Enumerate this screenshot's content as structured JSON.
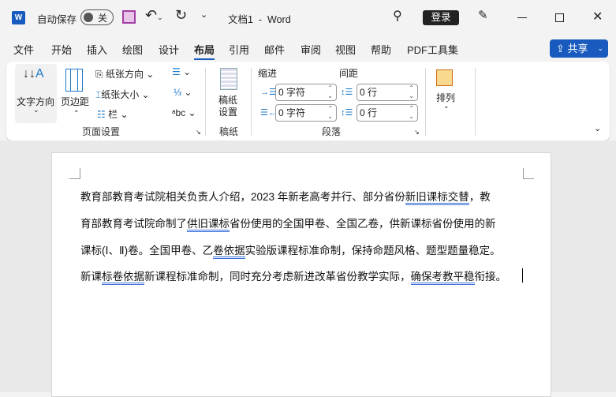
{
  "titlebar": {
    "autosave_label": "自动保存",
    "autosave_state": "关",
    "doc_title": "文档1  -  Word",
    "login": "登录"
  },
  "tabs": [
    "文件",
    "开始",
    "插入",
    "绘图",
    "设计",
    "布局",
    "引用",
    "邮件",
    "审阅",
    "视图",
    "帮助",
    "PDF工具集"
  ],
  "active_tab": "布局",
  "share": "共享",
  "ribbon": {
    "page_setup": {
      "text_direction": "文字方向",
      "margins": "页边距",
      "orientation": "纸张方向",
      "size": "纸张大小",
      "columns": "栏",
      "group": "页面设置"
    },
    "manuscript": {
      "setup": "稿纸\n设置",
      "setup_1": "稿纸",
      "setup_2": "设置",
      "group": "稿纸"
    },
    "paragraph": {
      "indent": "缩进",
      "spacing": "间距",
      "indent_left": "0 字符",
      "indent_right": "0 字符",
      "space_before": "0 行",
      "space_after": "0 行",
      "group": "段落"
    },
    "arrange": {
      "label": "排列"
    }
  },
  "document": {
    "lines": [
      [
        {
          "t": "教育部教育考试院相关负责人介绍，2023 年新老高考并行、部分省份"
        },
        {
          "t": "新旧课标交替",
          "u": true
        },
        {
          "t": "，教"
        }
      ],
      [
        {
          "t": "育部教育考试院命制了"
        },
        {
          "t": "供旧课标",
          "u": true
        },
        {
          "t": "省份使用的全国甲卷、全国乙卷，供新课标省份使用的新"
        }
      ],
      [
        {
          "t": "课标(Ⅰ、Ⅱ)卷。全国甲卷、乙"
        },
        {
          "t": "卷依据",
          "u": true
        },
        {
          "t": "实验版课程标准命制，保持命题风格、题型题量稳定。"
        }
      ],
      [
        {
          "t": "新课"
        },
        {
          "t": "标卷依据",
          "u": true
        },
        {
          "t": "新课程标准命制，同时充分考虑新进改革省份教学实际，"
        },
        {
          "t": "确保考教平稳",
          "u": true
        },
        {
          "t": "衔接。"
        }
      ]
    ]
  }
}
